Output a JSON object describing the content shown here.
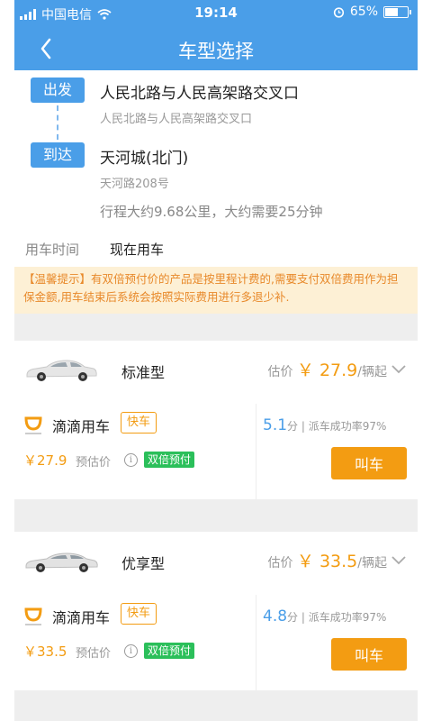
{
  "status": {
    "carrier": "中国电信",
    "time": "19:14",
    "battery": "65%",
    "battery_level": 0.65
  },
  "nav": {
    "title": "车型选择"
  },
  "route": {
    "from_tag": "出发",
    "from_main": "人民北路与人民高架路交叉口",
    "from_sub": "人民北路与人民高架路交叉口",
    "to_tag": "到达",
    "to_main": "天河城(北门)",
    "to_sub": "天河路208号",
    "trip_info": "行程大约9.68公里，大约需要25分钟"
  },
  "ride_time": {
    "label": "用车时间",
    "value": "现在用车"
  },
  "notice": "【温馨提示】有双倍预付价的产品是按里程计费的,需要支付双倍费用作为担保金额,用车结束后系统会按照实际费用进行多退少补.",
  "cars": [
    {
      "name": "标准型",
      "price_prefix": "估价",
      "price": "￥ 27.9",
      "price_suffix": "/辆起",
      "offer": {
        "provider": "滴滴用车",
        "badge": "快车",
        "price": "￥27.9",
        "price_label": "预估价",
        "prepay": "双倍预付",
        "eta_minutes": "5.1",
        "eta_unit": "分",
        "success_rate": "派车成功率97%",
        "button": "叫车"
      }
    },
    {
      "name": "优享型",
      "price_prefix": "估价",
      "price": "￥ 33.5",
      "price_suffix": "/辆起",
      "offer": {
        "provider": "滴滴用车",
        "badge": "快车",
        "price": "￥33.5",
        "price_label": "预估价",
        "prepay": "双倍预付",
        "eta_minutes": "4.8",
        "eta_unit": "分",
        "success_rate": "派车成功率97%",
        "button": "叫车"
      }
    }
  ],
  "icons": {
    "back": "chevron-left-icon",
    "expand": "chevron-down-icon",
    "info": "info-icon",
    "provider_logo": "didi-logo-icon"
  },
  "colors": {
    "primary": "#4a9ee8",
    "accent": "#f39c12",
    "success": "#2bbf5a",
    "notice_bg": "#fdf0d5"
  }
}
